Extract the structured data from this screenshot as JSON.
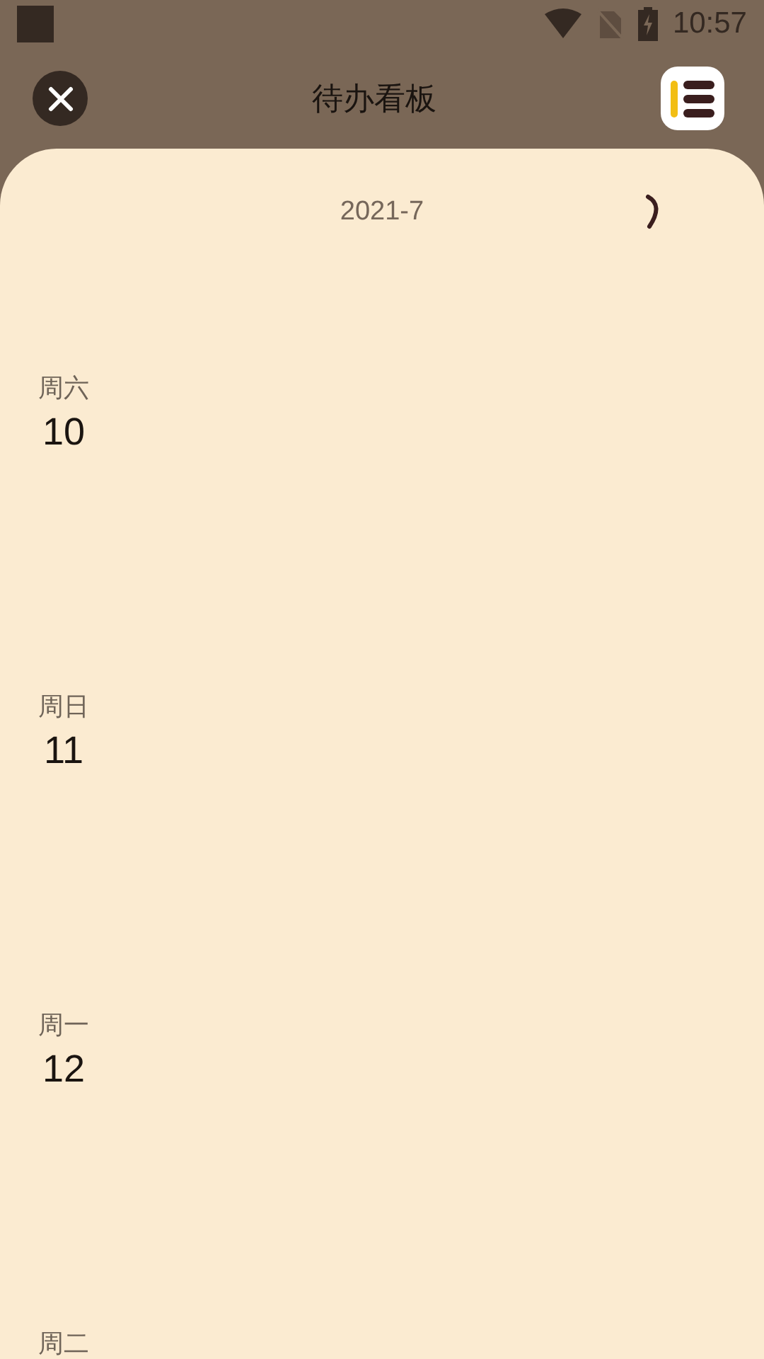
{
  "status_bar": {
    "time": "10:57"
  },
  "header": {
    "title": "待办看板"
  },
  "month": "2021-7",
  "days": [
    {
      "weekday": "周六",
      "day": "10"
    },
    {
      "weekday": "周日",
      "day": "11"
    },
    {
      "weekday": "周一",
      "day": "12"
    },
    {
      "weekday": "周二"
    }
  ]
}
